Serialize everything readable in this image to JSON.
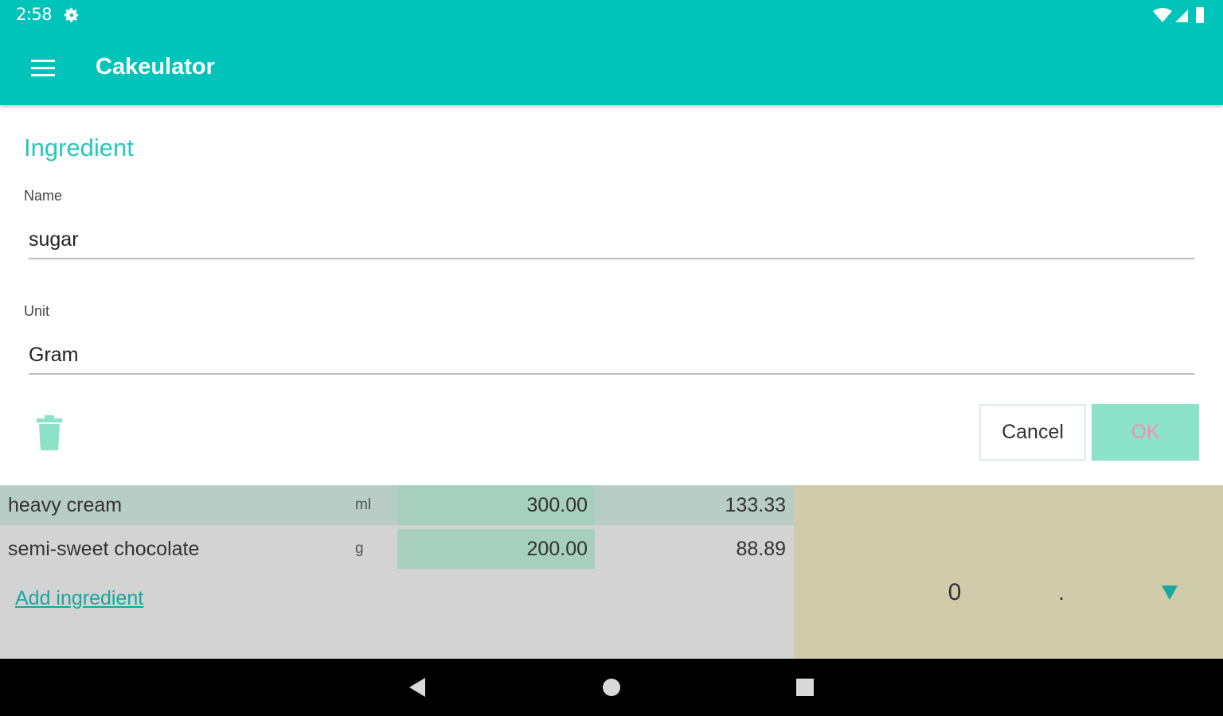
{
  "status_bar": {
    "time": "2:58",
    "icons": [
      "gear-icon",
      "wifi-icon",
      "signal-icon",
      "battery-icon"
    ]
  },
  "toolbar": {
    "menu_icon": "menu-icon",
    "title": "Cakeulator"
  },
  "dialog": {
    "title": "Ingredient",
    "name_label": "Name",
    "name_value": "sugar",
    "unit_label": "Unit",
    "unit_value": "Gram",
    "delete_icon": "trash-icon",
    "cancel_label": "Cancel",
    "ok_label": "OK"
  },
  "ingredients": [
    {
      "name": "heavy cream",
      "unit": "ml",
      "quantity": "300.00",
      "scaled": "133.33"
    },
    {
      "name": "semi-sweet chocolate",
      "unit": "g",
      "quantity": "200.00",
      "scaled": "88.89"
    }
  ],
  "add_ingredient_label": "Add ingredient",
  "keypad": {
    "zero": "0",
    "dot": ".",
    "collapse_icon": "triangle-down-icon"
  },
  "nav_bar": {
    "icons": [
      "back-icon",
      "home-icon",
      "recents-icon"
    ]
  },
  "colors": {
    "primary": "#00c4b9",
    "accent_text": "#28c7bb",
    "ok_button_bg": "#8be2c7",
    "ok_button_text": "#f48fb1",
    "keypad_bg": "#cfcbab",
    "table_bg": "#d3d3d3",
    "row_highlight": "#b8cdc6",
    "qty_cell_bg": "#a6cfbf"
  }
}
